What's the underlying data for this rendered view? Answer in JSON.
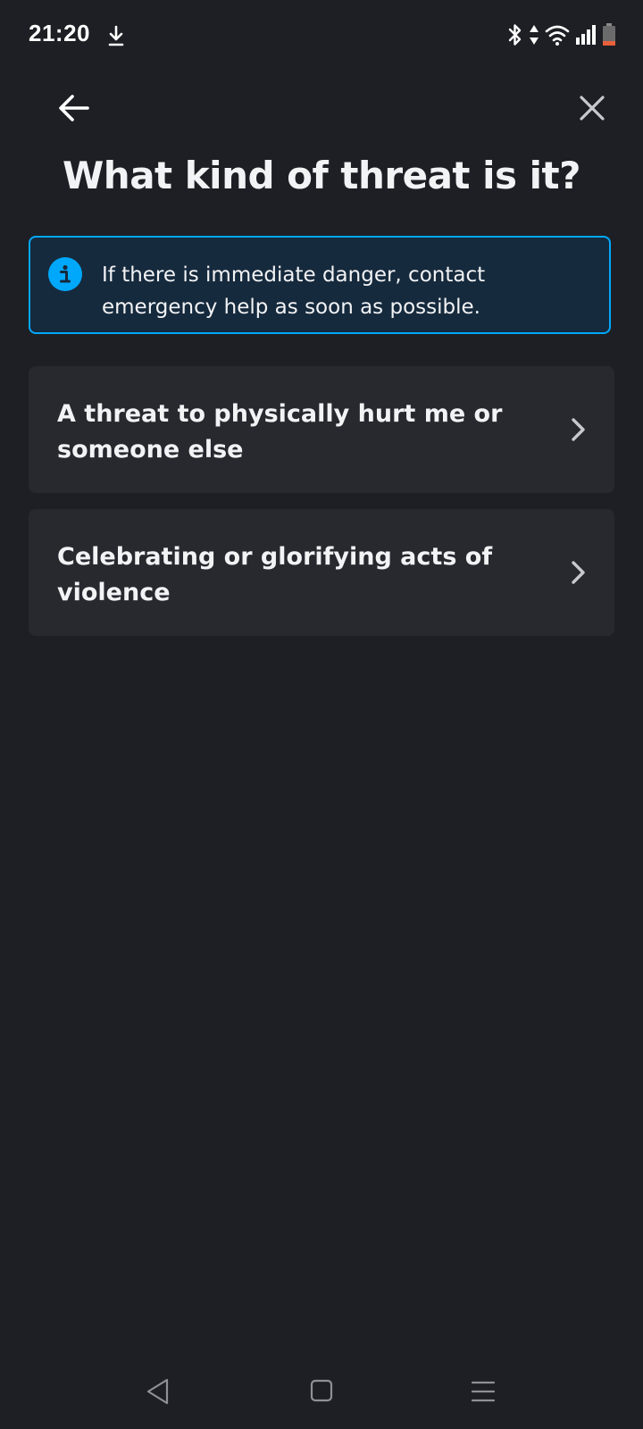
{
  "status_bar": {
    "time": "21:20",
    "icons": [
      "download-icon",
      "bluetooth-icon",
      "data-transfer-icon",
      "wifi-icon",
      "cell-signal-icon",
      "battery-low-icon"
    ],
    "battery_color": "#e8603c"
  },
  "header": {
    "back_icon": "arrow-left-icon",
    "close_icon": "close-icon",
    "title": "What kind of threat is it?"
  },
  "info_banner": {
    "icon": "info-icon",
    "text": "If there is immediate danger, contact emergency help as soon as possible.",
    "border_color": "#00a8fc",
    "background_color": "#162a3d"
  },
  "options": [
    {
      "label": "A threat to physically hurt me or someone else",
      "icon": "chevron-right-icon"
    },
    {
      "label": "Celebrating or glorifying acts of violence",
      "icon": "chevron-right-icon"
    }
  ],
  "nav_bar": {
    "icons": [
      "nav-back-icon",
      "nav-home-icon",
      "nav-menu-icon"
    ]
  },
  "colors": {
    "background": "#1e1f24",
    "card": "#28282f",
    "text": "#f2f3f5",
    "accent": "#00a8fc"
  }
}
